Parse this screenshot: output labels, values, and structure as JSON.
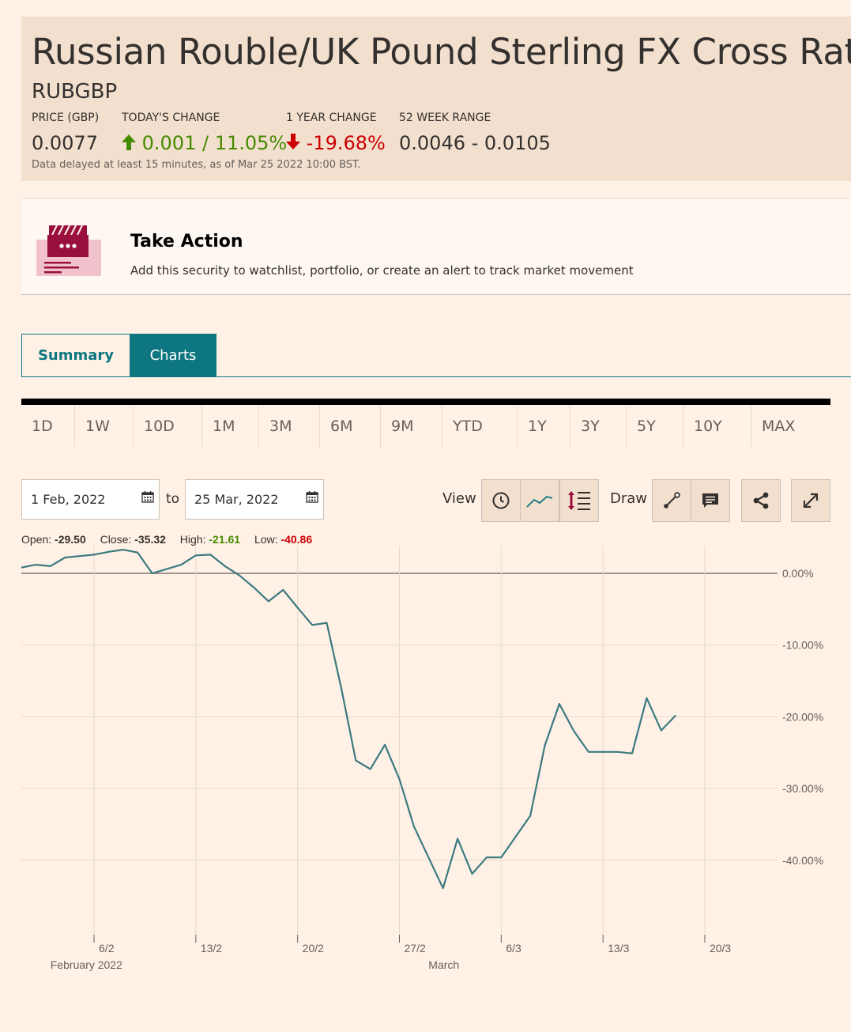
{
  "header": {
    "title": "Russian Rouble/UK Pound Sterling FX Cross Rate",
    "symbol": "RUBGBP",
    "price_label": "PRICE (GBP)",
    "price_value": "0.0077",
    "today_label": "TODAY'S CHANGE",
    "today_value": "0.001 / 11.05%",
    "year_label": "1 YEAR CHANGE",
    "year_value": "-19.68%",
    "range_label": "52 WEEK RANGE",
    "range_value": "0.0046 - 0.0105",
    "delay_note": "Data delayed at least 15 minutes, as of Mar 25 2022 10:00 BST.",
    "colors": {
      "up": "#458b00",
      "down": "#cc0000"
    }
  },
  "action": {
    "title": "Take Action",
    "description": "Add this security to watchlist, portfolio, or create an alert to track market movement",
    "icon": "alert-card-icon"
  },
  "tabs": [
    {
      "label": "Summary",
      "active": false
    },
    {
      "label": "Charts",
      "active": true
    }
  ],
  "ranges": [
    "1D",
    "1W",
    "10D",
    "1M",
    "3M",
    "6M",
    "9M",
    "YTD",
    "1Y",
    "3Y",
    "5Y",
    "10Y",
    "MAX"
  ],
  "controls": {
    "from_date": "1 Feb, 2022",
    "to_label": "to",
    "to_date": "25 Mar, 2022",
    "view_label": "View",
    "draw_label": "Draw",
    "view_icons": [
      "clock-icon",
      "line-chart-icon",
      "indicator-icon"
    ],
    "draw_icons": [
      "draw-line-icon",
      "annotation-icon"
    ],
    "share_icon": "share-icon",
    "expand_icon": "expand-icon"
  },
  "legend": {
    "open_label": "Open:",
    "open_value": "-29.50",
    "close_label": "Close:",
    "close_value": "-35.32",
    "high_label": "High:",
    "high_value": "-21.61",
    "low_label": "Low:",
    "low_value": "-40.86"
  },
  "chart_data": {
    "type": "line",
    "ylim": [
      -48,
      3.5
    ],
    "yticks": [
      "0.00%",
      "-10.00%",
      "-20.00%",
      "-30.00%",
      "-40.00%"
    ],
    "ytick_values": [
      0,
      -10,
      -20,
      -30,
      -40
    ],
    "x_date_range": [
      "2022-02-01",
      "2022-03-25"
    ],
    "xticks": [
      "6/2",
      "13/2",
      "20/2",
      "27/2",
      "6/3",
      "13/3",
      "20/3"
    ],
    "xtick_dates": [
      "2022-02-06",
      "2022-02-13",
      "2022-02-20",
      "2022-02-27",
      "2022-03-06",
      "2022-03-13",
      "2022-03-20"
    ],
    "month_labels": [
      "February 2022",
      "March"
    ],
    "month_label_dates": [
      "2022-02-03",
      "2022-03-01"
    ],
    "line_color": "#3b7a80",
    "series": [
      {
        "dates": [
          "2022-02-01",
          "2022-02-02",
          "2022-02-03",
          "2022-02-04",
          "2022-02-05",
          "2022-02-06",
          "2022-02-07",
          "2022-02-08",
          "2022-02-09",
          "2022-02-10",
          "2022-02-11",
          "2022-02-12",
          "2022-02-13",
          "2022-02-14",
          "2022-02-15",
          "2022-02-16",
          "2022-02-17",
          "2022-02-18",
          "2022-02-19",
          "2022-02-20",
          "2022-02-21",
          "2022-02-22",
          "2022-02-23",
          "2022-02-24",
          "2022-02-25",
          "2022-02-26",
          "2022-02-27",
          "2022-02-28",
          "2022-03-01",
          "2022-03-02",
          "2022-03-03",
          "2022-03-04",
          "2022-03-05",
          "2022-03-06",
          "2022-03-07",
          "2022-03-08",
          "2022-03-09",
          "2022-03-10",
          "2022-03-11",
          "2022-03-12",
          "2022-03-13",
          "2022-03-14",
          "2022-03-15",
          "2022-03-16",
          "2022-03-17",
          "2022-03-18",
          "2022-03-19",
          "2022-03-20",
          "2022-03-21",
          "2022-03-22",
          "2022-03-23",
          "2022-03-24",
          "2022-03-25"
        ],
        "values": [
          0.8,
          1.2,
          1.0,
          2.2,
          2.4,
          2.6,
          3.0,
          3.3,
          2.9,
          0.0,
          0.6,
          1.2,
          2.5,
          2.6,
          1.0,
          -0.3,
          -2.0,
          -3.9,
          -2.3,
          -4.8,
          -7.2,
          -6.9,
          -16.0,
          -26.1,
          -27.3,
          -23.9,
          -28.7,
          -35.3,
          -39.6,
          -43.9,
          -37.0,
          -41.9,
          -39.6,
          -39.6,
          -36.7,
          -33.8,
          -24.0,
          -18.2,
          -22.0,
          -24.9,
          -24.9,
          -24.9,
          -25.1,
          -17.4,
          -21.9,
          -19.8
        ]
      }
    ]
  }
}
